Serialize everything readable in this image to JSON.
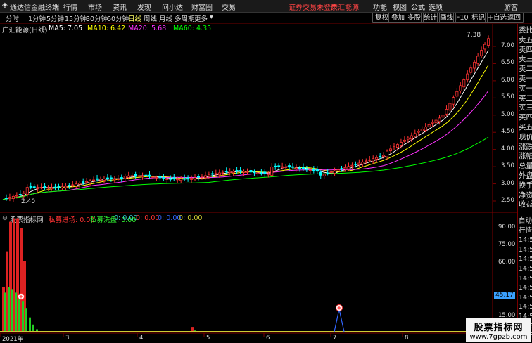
{
  "app": {
    "title": "通达信金融终端",
    "menu": [
      "行情",
      "市场",
      "资讯",
      "发现",
      "问小达",
      "财富圈",
      "交易"
    ],
    "notice": "证券交易未登录",
    "stock_tag": "广汇能源",
    "right_menu": [
      "功能",
      "视图",
      "公式",
      "选项"
    ],
    "guest": "游客"
  },
  "toolbar": {
    "periods": [
      "分时",
      "1分钟",
      "5分钟",
      "15分钟",
      "30分钟",
      "60分钟",
      "日线",
      "周线",
      "月线",
      "多周期",
      "更多"
    ],
    "active_period": "日线",
    "actions": [
      "复权",
      "叠加",
      "多股",
      "统计",
      "画线",
      "F10",
      "标记",
      "+自选",
      "返回"
    ]
  },
  "main_chart": {
    "title": "广汇能源(日线)",
    "ma": [
      {
        "label": "MA5: 7.05",
        "color": "#ffffff"
      },
      {
        "label": "MA10: 6.42",
        "color": "#ffff00"
      },
      {
        "label": "MA20: 5.68",
        "color": "#ff33ff"
      },
      {
        "label": "MA60: 4.35",
        "color": "#00ff00"
      }
    ],
    "high_label": "7.38",
    "low_label": "2.40",
    "y_ticks": [
      "7.00",
      "6.50",
      "6.00",
      "5.50",
      "5.00",
      "4.50",
      "4.00",
      "3.50",
      "3.00",
      "2.50"
    ]
  },
  "indicator": {
    "name": "股票指标网",
    "items": [
      {
        "label": "私募进场: 0.00",
        "color": "#ff3333"
      },
      {
        "label": "私募洗盘: 0.00",
        "color": "#33ff33"
      },
      {
        "label": "0: 0.00",
        "color": "#33cccc"
      },
      {
        "label": "0: 0.00",
        "color": "#ff3333"
      },
      {
        "label": "0: 0.00",
        "color": "#3366ff"
      },
      {
        "label": "0: 0.00",
        "color": "#cccc33"
      }
    ],
    "y_ticks": [
      "90.00",
      "75.00",
      "60.00",
      "30.00",
      "15.00"
    ],
    "current_value": "45.17"
  },
  "x_axis": {
    "labels": [
      "2021年",
      "3",
      "4",
      "5",
      "6",
      "7",
      "8"
    ]
  },
  "right_panel": {
    "items": [
      "委比",
      "卖五",
      "卖四",
      "卖三",
      "卖二",
      "卖一",
      "买一",
      "买二",
      "买三",
      "买四",
      "买五",
      "现价",
      "涨跌",
      "涨幅",
      "总量",
      "外盘",
      "换手",
      "净资",
      "收益"
    ],
    "bottom": [
      "自动",
      "行情",
      "14:50",
      "14:50",
      "14:50",
      "14:50",
      "14:50",
      "14:50",
      "14:50",
      "14:50",
      "14:50",
      "14:50",
      "14:50"
    ]
  },
  "watermark": {
    "title": "股票指标网",
    "url": "www.7gpzb.com"
  },
  "colors": {
    "up": "#ff3333",
    "down": "#00ffff",
    "ma5": "#ffffff",
    "ma10": "#ffff00",
    "ma20": "#ff33ff",
    "ma60": "#00ff00"
  }
}
